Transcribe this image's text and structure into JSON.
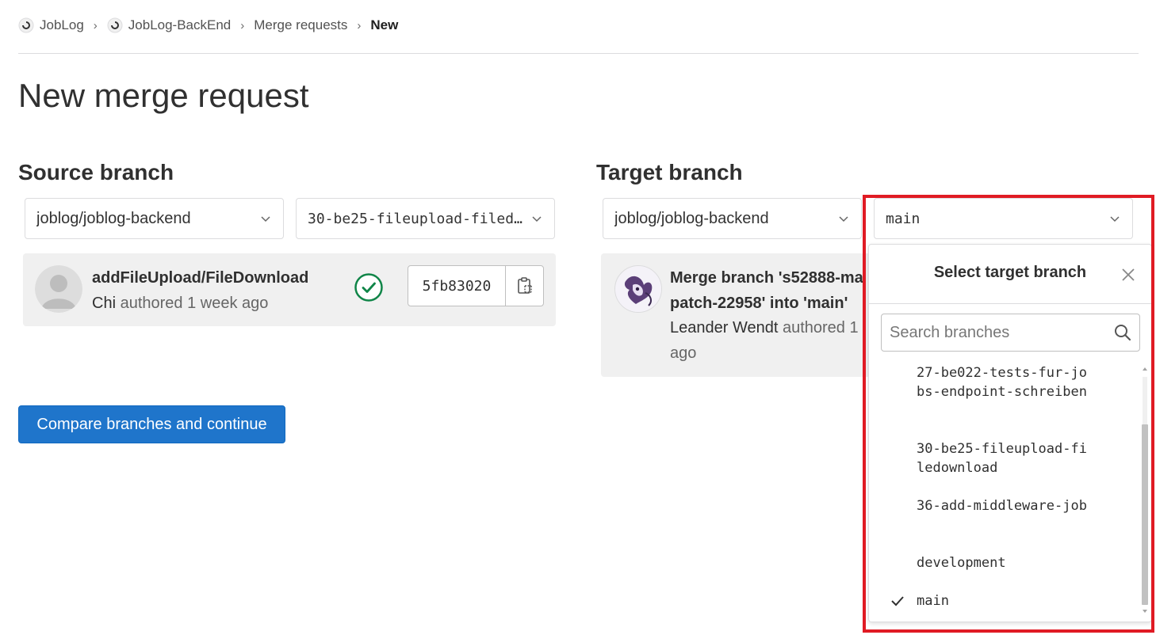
{
  "breadcrumb": {
    "items": [
      "JobLog",
      "JobLog-BackEnd",
      "Merge requests"
    ],
    "current": "New"
  },
  "page": {
    "title": "New merge request"
  },
  "source": {
    "heading": "Source branch",
    "project": "joblog/joblog-backend",
    "branch": "30-be25-fileupload-filedownload",
    "commit": {
      "title": "addFileUpload/FileDownload",
      "author": "Chi",
      "authored_text": "authored 1 week ago",
      "sha": "5fb83020",
      "status": "success"
    }
  },
  "target": {
    "heading": "Target branch",
    "project": "joblog/joblog-backend",
    "branch": "main",
    "commit": {
      "title_line1": "Merge branch 's52888-ma",
      "title_line2": "patch-22958' into 'main'",
      "author": "Leander Wendt",
      "authored_text": "authored 1",
      "ago": "ago"
    }
  },
  "compare_button": "Compare branches and continue",
  "dropdown": {
    "title": "Select target branch",
    "search_placeholder": "Search branches",
    "items": [
      {
        "label": "27-be022-tests-fur-jobs-endpoint-schreiben",
        "selected": false
      },
      {
        "label": "30-be25-fileupload-filedownload",
        "selected": false
      },
      {
        "label": "36-add-middleware-job",
        "selected": false
      },
      {
        "label": "development",
        "selected": false
      },
      {
        "label": "main",
        "selected": true
      }
    ]
  },
  "colors": {
    "primary": "#1f75cb",
    "success": "#108548",
    "highlight": "#e01b24"
  }
}
